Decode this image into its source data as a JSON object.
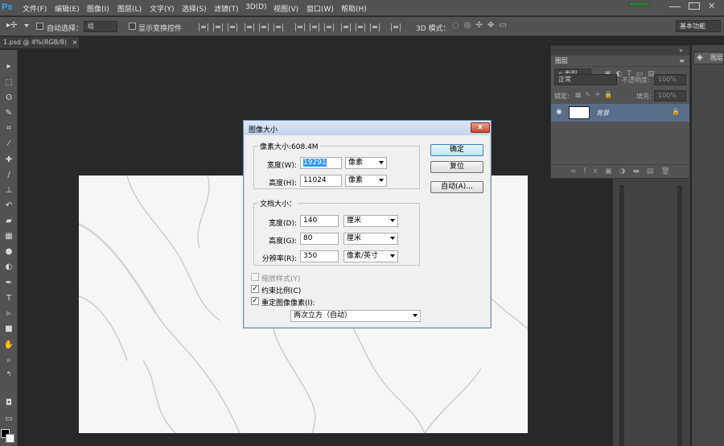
{
  "app": {
    "logo": "Ps"
  },
  "menu": [
    "文件(F)",
    "编辑(E)",
    "图像(I)",
    "图层(L)",
    "文字(Y)",
    "选择(S)",
    "滤镜(T)",
    "3D(D)",
    "视图(V)",
    "窗口(W)",
    "帮助(H)"
  ],
  "options": {
    "auto_select_label": "自动选择：",
    "auto_select_value": "组",
    "show_transform_label": "显示变换控件",
    "mode_3d_label": "3D 模式：",
    "workspace": "基本功能"
  },
  "document": {
    "tab_label": "1.psd @ 4%(RGB/8)",
    "tab_close": "×"
  },
  "layers": {
    "panel_title": "图层",
    "filter_label": "ρ 类型",
    "blend_mode": "正常",
    "opacity_label": "不透明度:",
    "opacity_value": "100%",
    "lock_label": "锁定:",
    "fill_label": "填充:",
    "fill_value": "100%",
    "layer_name": "背景",
    "mini_tab_label": "图层"
  },
  "dialog": {
    "title": "图像大小",
    "close": "x",
    "pixel_group_title": "像素大小:608.4M",
    "width_label": "宽度(W):",
    "width_value": "19291",
    "width_unit": "像素",
    "height_label": "高度(H):",
    "height_value": "11024",
    "height_unit": "像素",
    "doc_group_title": "文档大小：",
    "doc_width_label": "宽度(D):",
    "doc_width_value": "140",
    "doc_width_unit": "厘米",
    "doc_height_label": "高度(G):",
    "doc_height_value": "80",
    "doc_height_unit": "厘米",
    "res_label": "分辨率(R):",
    "res_value": "350",
    "res_unit": "像素/英寸",
    "scale_styles": "缩放样式(Y)",
    "constrain": "约束比例(C)",
    "resample": "重定图像像素(I):",
    "resample_method": "两次立方（自动）",
    "ok": "确定",
    "reset": "复位",
    "auto": "自动(A)...",
    "constrain_checked": true,
    "resample_checked": true,
    "scale_styles_checked": false
  }
}
